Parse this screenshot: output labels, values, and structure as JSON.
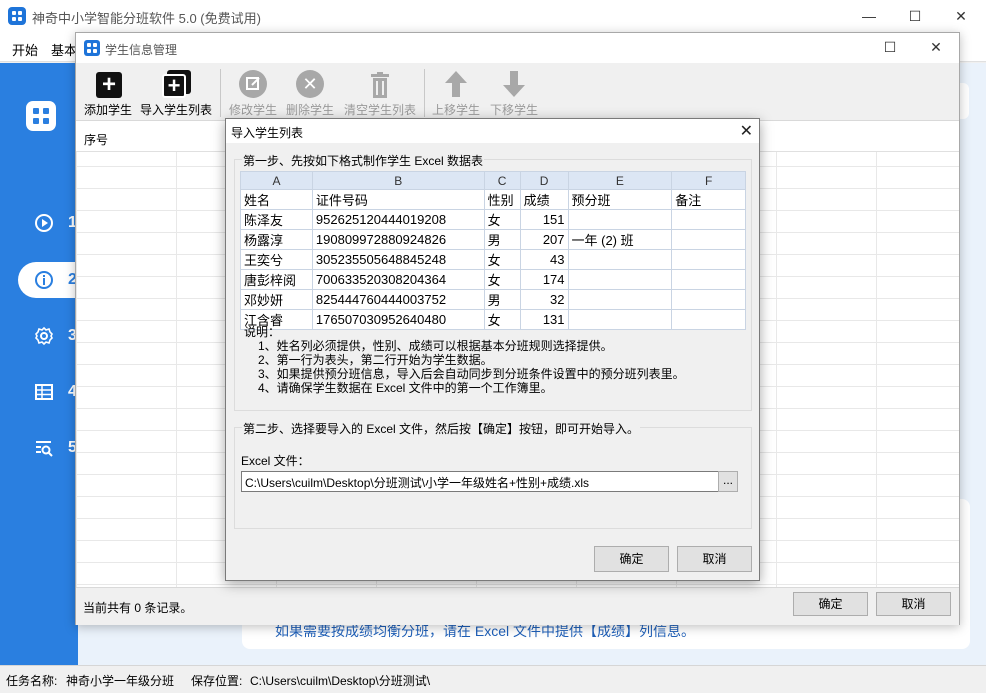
{
  "app": {
    "title": "神奇中小学智能分班软件 5.0 (免费试用)",
    "menu": [
      "开始",
      "基本"
    ],
    "window_buttons": {
      "minimize": "—",
      "maximize": "☐",
      "close": "✕"
    },
    "sidebar": {
      "items": [
        {
          "number": "1",
          "icon": "play-circle-icon"
        },
        {
          "number": "2",
          "icon": "info-circle-icon",
          "active": true
        },
        {
          "number": "3",
          "icon": "gear-icon"
        },
        {
          "number": "4",
          "icon": "table-icon"
        },
        {
          "number": "5",
          "icon": "search-list-icon"
        }
      ]
    },
    "hint": "如果需要按成绩均衡分班，请在 Excel 文件中提供【成绩】列信息。",
    "status": {
      "task_label": "任务名称:",
      "task_value": "神奇小学一年级分班",
      "save_label": "保存位置:",
      "save_value": "C:\\Users\\cuilm\\Desktop\\分班测试\\"
    }
  },
  "student_window": {
    "title": "学生信息管理",
    "toolbar": {
      "add": "添加学生",
      "import": "导入学生列表",
      "edit": "修改学生",
      "delete": "删除学生",
      "clear": "清空学生列表",
      "move_up": "上移学生",
      "move_down": "下移学生"
    },
    "list_header": "序号",
    "record_count": "当前共有 0 条记录。",
    "ok": "确定",
    "cancel": "取消"
  },
  "import_dialog": {
    "title": "导入学生列表",
    "close": "✕",
    "step1": "第一步、先按如下格式制作学生 Excel 数据表",
    "sheet": {
      "columns": [
        "A",
        "B",
        "C",
        "D",
        "E",
        "F"
      ],
      "header": [
        "姓名",
        "证件号码",
        "性别",
        "成绩",
        "预分班",
        "备注"
      ],
      "rows": [
        [
          "陈泽友",
          "952625120444019208",
          "女",
          "151",
          "",
          ""
        ],
        [
          "杨露淳",
          "190809972880924826",
          "男",
          "207",
          "一年 (2) 班",
          ""
        ],
        [
          "王奕兮",
          "305235505648845248",
          "女",
          "43",
          "",
          ""
        ],
        [
          "唐彭梓阅",
          "700633520308204364",
          "女",
          "174",
          "",
          ""
        ],
        [
          "邓妙妍",
          "825444760444003752",
          "男",
          "32",
          "",
          ""
        ],
        [
          "江含睿",
          "176507030952640480",
          "女",
          "131",
          "",
          ""
        ]
      ]
    },
    "notes_title": "说明：",
    "notes": [
      "1、姓名列必须提供，性别、成绩可以根据基本分班规则选择提供。",
      "2、第一行为表头，第二行开始为学生数据。",
      "3、如果提供预分班信息，导入后会自动同步到分班条件设置中的预分班列表里。",
      "4、请确保学生数据在 Excel 文件中的第一个工作簿里。"
    ],
    "step2": "第二步、选择要导入的 Excel 文件，然后按【确定】按钮，即可开始导入。",
    "file_label": "Excel 文件：",
    "file_value": "C:\\Users\\cuilm\\Desktop\\分班测试\\小学一年级姓名+性别+成绩.xls",
    "browse": "...",
    "ok": "确定",
    "cancel": "取消"
  }
}
